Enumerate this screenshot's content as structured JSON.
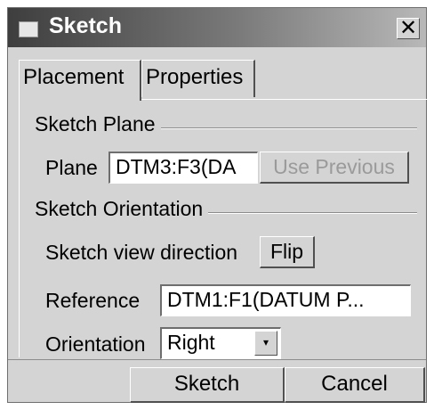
{
  "window": {
    "title": "Sketch",
    "close_glyph": "✕",
    "title_icon": "window-icon"
  },
  "tabs": [
    {
      "label": "Placement",
      "active": true
    },
    {
      "label": "Properties",
      "active": false
    }
  ],
  "sketch_plane": {
    "heading": "Sketch Plane",
    "plane_label": "Plane",
    "plane_value": "DTM3:F3(DA",
    "use_previous_label": "Use Previous"
  },
  "sketch_orientation": {
    "heading": "Sketch Orientation",
    "view_direction_label": "Sketch view direction",
    "flip_label": "Flip",
    "reference_label": "Reference",
    "reference_value": "DTM1:F1(DATUM P...",
    "orientation_label": "Orientation",
    "orientation_value": "Right",
    "dropdown_glyph": "▾"
  },
  "footer": {
    "sketch_label": "Sketch",
    "cancel_label": "Cancel"
  }
}
